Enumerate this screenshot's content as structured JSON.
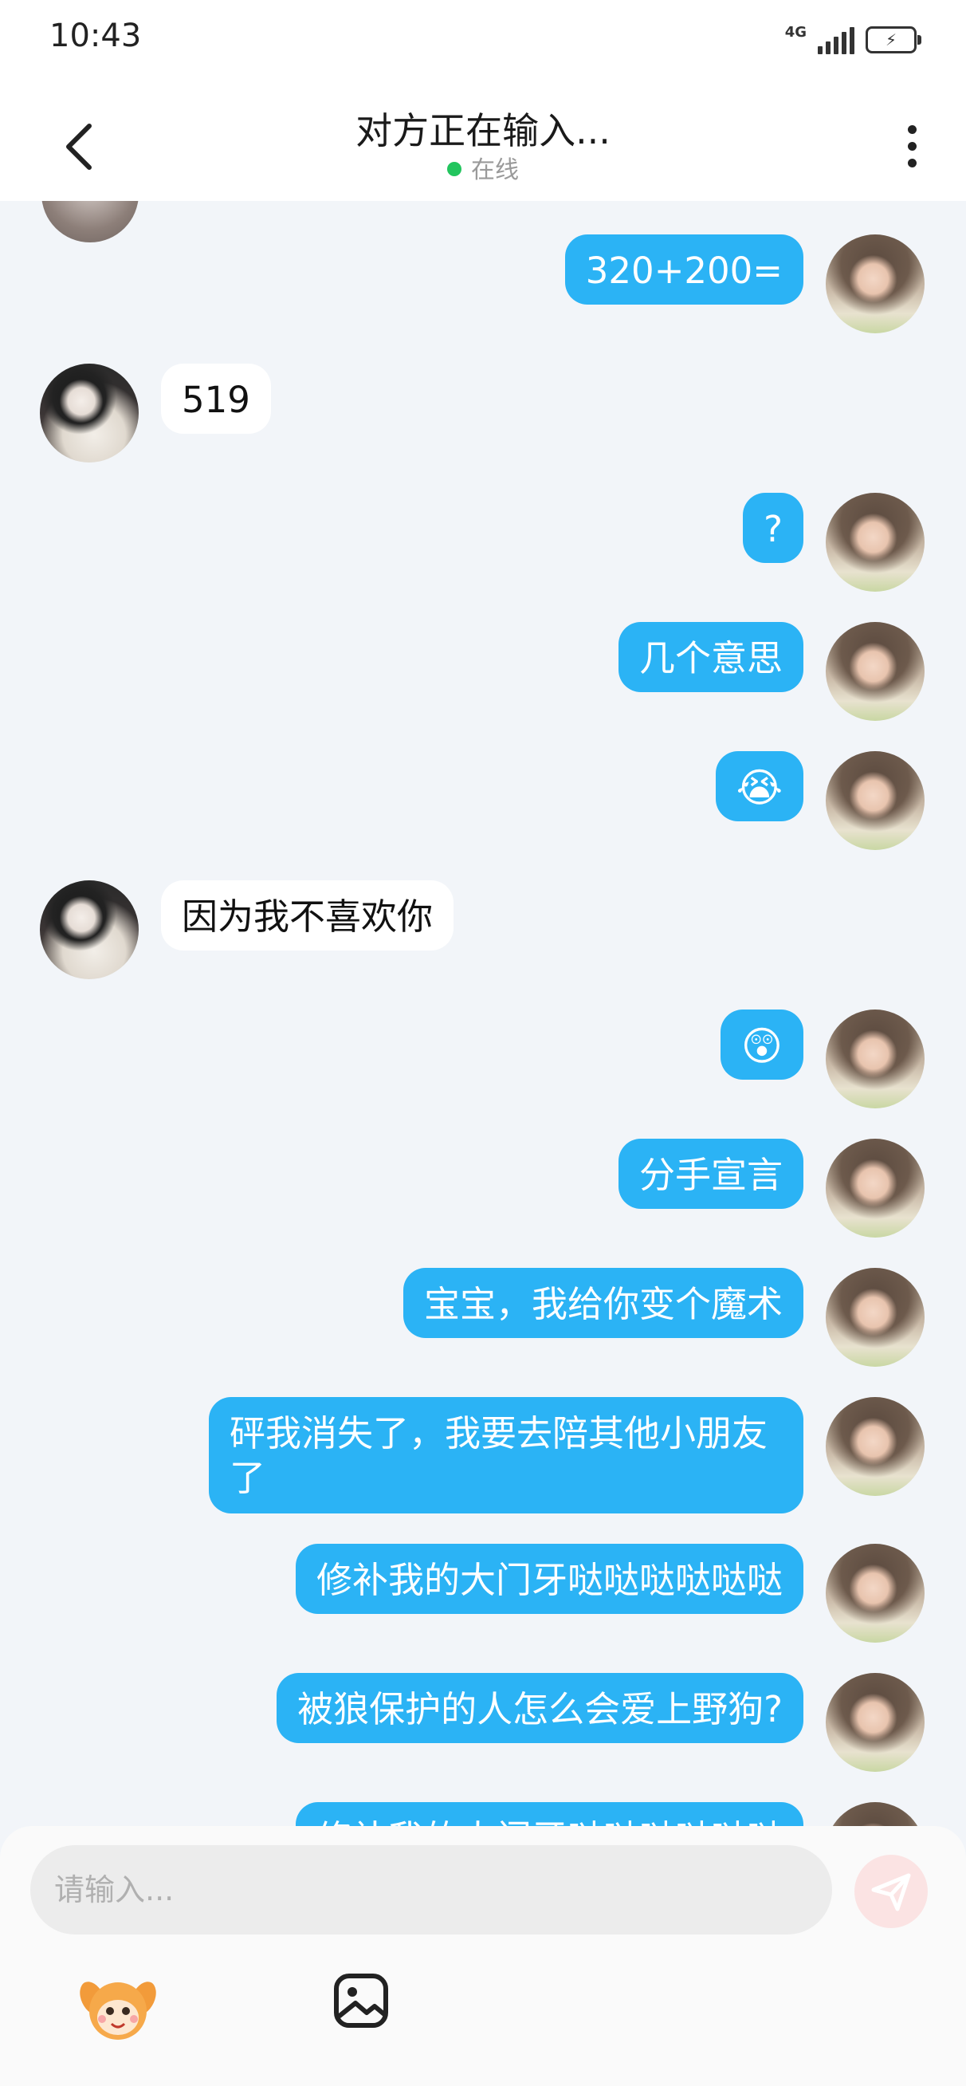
{
  "status_bar": {
    "time": "10:43",
    "network": "4G"
  },
  "header": {
    "title": "对方正在输入...",
    "status": "在线"
  },
  "messages": [
    {
      "from": "me",
      "text": "320+200="
    },
    {
      "from": "them",
      "text": "519"
    },
    {
      "from": "me",
      "text": "?"
    },
    {
      "from": "me",
      "text": "几个意思"
    },
    {
      "from": "me",
      "text": "😭"
    },
    {
      "from": "them",
      "text": "因为我不喜欢你"
    },
    {
      "from": "me",
      "text": "😲"
    },
    {
      "from": "me",
      "text": "分手宣言"
    },
    {
      "from": "me",
      "text": "宝宝，我给你变个魔术"
    },
    {
      "from": "me",
      "text": "砰我消失了，我要去陪其他小朋友了"
    },
    {
      "from": "me",
      "text": "修补我的大门牙哒哒哒哒哒哒"
    },
    {
      "from": "me",
      "text": "被狼保护的人怎么会爱上野狗?"
    },
    {
      "from": "me",
      "text": "修补我的大门牙哒哒哒哒哒哒"
    }
  ],
  "composer": {
    "placeholder": "请输入..."
  },
  "colors": {
    "my_bubble": "#2bb3f5",
    "their_bubble": "#ffffff",
    "online_dot": "#22c55e",
    "background": "#f2f5f9"
  }
}
